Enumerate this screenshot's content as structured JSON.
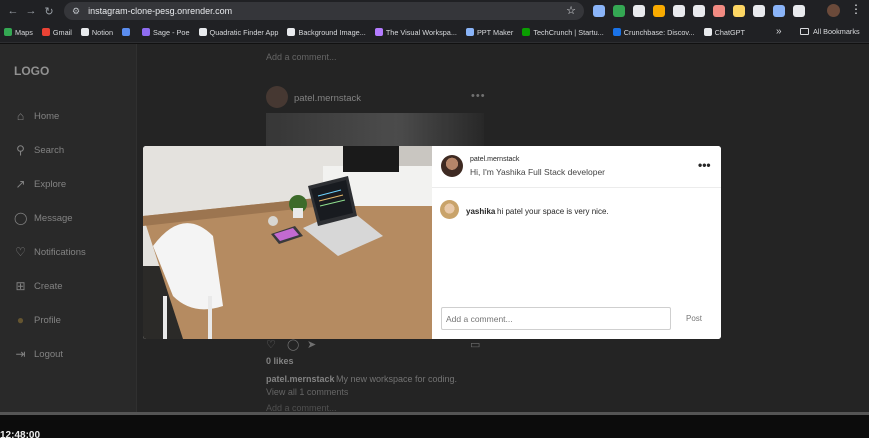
{
  "browser": {
    "url": "instagram-clone-pesg.onrender.com",
    "nav_back": "←",
    "nav_forward": "→",
    "nav_reload": "↻",
    "menu": "⋮",
    "extension_colors": [
      "#8ab4f8",
      "#34a853",
      "#e8eaed",
      "#f9ab00",
      "#e8eaed",
      "#e8eaed",
      "#f28b82",
      "#fdd663",
      "#e8eaed",
      "#8ab4f8",
      "#e8eaed"
    ]
  },
  "bookmarks": {
    "items": [
      {
        "label": "Maps",
        "color": "#34a853"
      },
      {
        "label": "Gmail",
        "color": "#ea4335"
      },
      {
        "label": "Notion",
        "color": "#e8eaed"
      },
      {
        "label": "",
        "color": "#5b8def"
      },
      {
        "label": "Sage - Poe",
        "color": "#8e6cf0"
      },
      {
        "label": "Quadratic Finder App",
        "color": "#e8eaed"
      },
      {
        "label": "Background Image...",
        "color": "#e8eaed"
      },
      {
        "label": "The Visual Workspa...",
        "color": "#b47cff"
      },
      {
        "label": "PPT Maker",
        "color": "#8ab4f8"
      },
      {
        "label": "TechCrunch | Startu...",
        "color": "#0a9e01"
      },
      {
        "label": "Crunchbase: Discov...",
        "color": "#1a73e8"
      },
      {
        "label": "ChatGPT",
        "color": "#e8eaed"
      }
    ],
    "more": "»",
    "all_bookmarks": "All Bookmarks"
  },
  "sidebar": {
    "logo": "LOGO",
    "items": [
      {
        "label": "Home",
        "icon": "⌂"
      },
      {
        "label": "Search",
        "icon": "⚲"
      },
      {
        "label": "Explore",
        "icon": "↗"
      },
      {
        "label": "Message",
        "icon": "◯"
      },
      {
        "label": "Notifications",
        "icon": "♡"
      },
      {
        "label": "Create",
        "icon": "⊞"
      },
      {
        "label": "Profile",
        "icon": "●"
      },
      {
        "label": "Logout",
        "icon": "⇥"
      }
    ]
  },
  "feed": {
    "add_comment_top": "Add a comment...",
    "post_user": "patel.mernstack",
    "likes": "0 likes",
    "caption_user": "patel.mernstack",
    "caption_text": "My new workspace for coding.",
    "view_comments": "View all 1 comments",
    "add_comment_bottom": "Add a comment..."
  },
  "modal": {
    "user": "patel.mernstack",
    "caption": "Hi, I'm Yashika Full Stack developer",
    "more": "•••",
    "comments": [
      {
        "user": "yashika",
        "text": "hi patel your space is very nice."
      }
    ],
    "input_placeholder": "Add a comment...",
    "post_label": "Post"
  },
  "video": {
    "time": "12:48:00"
  }
}
